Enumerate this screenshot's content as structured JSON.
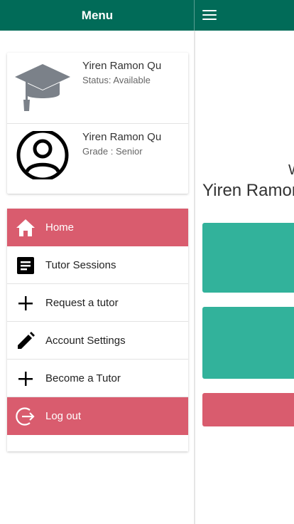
{
  "header": {
    "title": "Menu"
  },
  "profile": [
    {
      "name": "Yiren Ramon Qu",
      "detail": "Status: Available",
      "icon": "graduation-cap-icon"
    },
    {
      "name": "Yiren Ramon Qu",
      "detail": "Grade : Senior",
      "icon": "user-circle-icon"
    }
  ],
  "nav": {
    "items": [
      {
        "label": "Home",
        "icon": "home-icon",
        "active": true
      },
      {
        "label": "Tutor Sessions",
        "icon": "document-icon"
      },
      {
        "label": "Request a tutor",
        "icon": "plus-icon"
      },
      {
        "label": "Account Settings",
        "icon": "pencil-icon"
      },
      {
        "label": "Become a Tutor",
        "icon": "plus-icon"
      },
      {
        "label": "Log out",
        "icon": "logout-icon"
      }
    ]
  },
  "main": {
    "welcome_fragment": "W",
    "name": "Yiren Ramon Qu"
  },
  "colors": {
    "primary": "#016b58",
    "accent_red": "#d95c6e",
    "tile_teal": "#32b29b"
  }
}
